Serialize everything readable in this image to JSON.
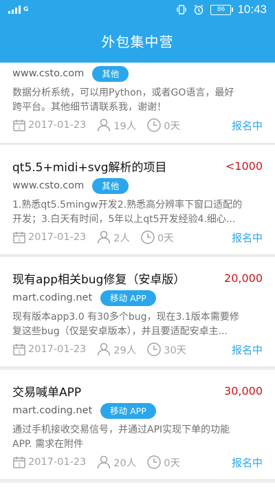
{
  "status_bar": {
    "network": "G",
    "battery": "86",
    "time": "10:43"
  },
  "header": {
    "title": "外包集中营"
  },
  "projects": [
    {
      "source": "www.csto.com",
      "tag": "其他",
      "desc_line1": "数据分析系统，可以用Python，或者GO语言，最好",
      "desc_line2": "跨平台。其他细节请联系我，谢谢！",
      "date": "2017-01-23",
      "people": "19人",
      "days": "0天",
      "status": "报名中"
    },
    {
      "title": "qt5.5+midi+svg解析的项目",
      "price": "<1000",
      "source": "www.csto.com",
      "tag": "其他",
      "desc_line1": "1.熟悉qt5.5mingw开发2.熟悉高分辨率下窗口适配的",
      "desc_line2": "开发；3.白天有时间，5年以上qt5开发经验4.细心...",
      "date": "2017-01-23",
      "people": "2人",
      "days": "0天",
      "status": "报名中"
    },
    {
      "title": "现有app相关bug修复（安卓版）",
      "price": "20,000",
      "source": "mart.coding.net",
      "tag": "移动 APP",
      "desc_line1": "现有版本app3.0 有30多个bug，现在3.1版本需要修",
      "desc_line2": "复这些bug（仅是安卓版本），并且要适配安卓主...",
      "date": "2017-01-23",
      "people": "29人",
      "days": "30天",
      "status": "报名中"
    },
    {
      "title": "交易喊单APP",
      "price": "30,000",
      "source": "mart.coding.net",
      "tag": "移动 APP",
      "desc_line1": "通过手机接收交易信号，并通过API实现下单的功能",
      "desc_line2": "APP. 需求在附件",
      "date": "2017-01-23",
      "people": "20人",
      "days": "0天",
      "status": "报名中"
    }
  ]
}
